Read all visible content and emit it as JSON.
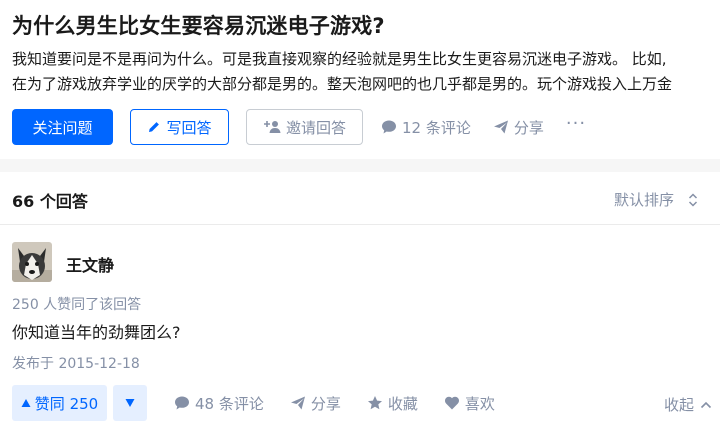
{
  "question": {
    "title": "为什么男生比女生要容易沉迷电子游戏?",
    "excerpt_line1": "我知道要问是不是再问为什么。可是我直接观察的经验就是男生比女生更容易沉迷电子游戏。 比如,",
    "excerpt_line2": "在为了游戏放弃学业的厌学的大部分都是男的。整天泡网吧的也几乎都是男的。玩个游戏投入上万金",
    "follow_label": "关注问题",
    "write_label": "写回答",
    "invite_label": "邀请回答",
    "comments_label": "12 条评论",
    "share_label": "分享",
    "more_label": "···"
  },
  "answers": {
    "count_label": "66 个回答",
    "sort_label": "默认排序"
  },
  "answer": {
    "author": "王文静",
    "vote_summary": "250 人赞同了该回答",
    "content": "你知道当年的劲舞团么?",
    "publish_time": "发布于 2015-12-18",
    "vote_label": "赞同 250",
    "comments_label": "48 条评论",
    "share_label": "分享",
    "collect_label": "收藏",
    "like_label": "喜欢",
    "collapse_label": "收起"
  },
  "colors": {
    "primary": "#0066ff",
    "muted": "#8590a6",
    "vote_bg": "#e5efff"
  },
  "icons": [
    "pencil-icon",
    "invite-user-icon",
    "comment-icon",
    "share-icon",
    "sort-icon",
    "upvote-icon",
    "downvote-icon",
    "star-icon",
    "heart-icon",
    "chevron-up-icon"
  ]
}
